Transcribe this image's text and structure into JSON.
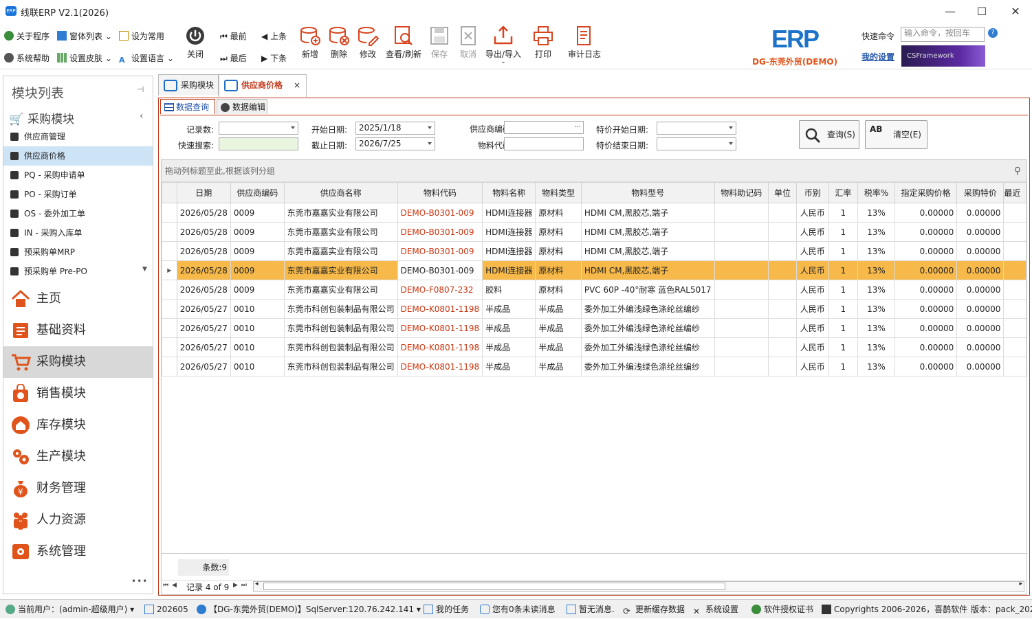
{
  "window": {
    "title": "线联ERP V2.1(2026)",
    "logo": "ERP"
  },
  "ribbon": {
    "small_left": [
      {
        "label": "关于程序",
        "icon": "gear-icon"
      },
      {
        "label": "窗体列表",
        "icon": "windows-icon"
      },
      {
        "label": "设为常用",
        "icon": "clipboard-icon"
      },
      {
        "label": "系统帮助",
        "icon": "help-icon"
      },
      {
        "label": "设置皮肤",
        "icon": "grid-icon"
      },
      {
        "label": "设置语言",
        "icon": "language-icon"
      }
    ],
    "close": "关闭",
    "nav": {
      "first": "最前",
      "prev": "上条",
      "last": "最后",
      "next": "下条"
    },
    "buttons": [
      "新增",
      "删除",
      "修改",
      "查看/刷新",
      "保存",
      "取消",
      "导出/导入",
      "打印",
      "审计日志"
    ],
    "brand": {
      "name": "DG-东莞外贸(DEMO)",
      "logo": "ERP"
    },
    "quick_cmd_label": "快速命令",
    "quick_cmd_placeholder": "输入命令，按回车",
    "my_settings": "我的设置",
    "banner": "CSFramework"
  },
  "left": {
    "header": "模块列表",
    "group": "采购模块",
    "items": [
      "供应商管理",
      "供应商价格",
      "PQ - 采购申请单",
      "PO - 采购订单",
      "OS - 委外加工单",
      "IN - 采购入库单",
      "预采购单MRP",
      "预采购单 Pre-PO"
    ],
    "modules": [
      "主页",
      "基础资料",
      "采购模块",
      "销售模块",
      "库存模块",
      "生产模块",
      "财务管理",
      "人力资源",
      "系统管理"
    ],
    "more": "•••"
  },
  "tabs": [
    {
      "label": "采购模块"
    },
    {
      "label": "供应商价格"
    }
  ],
  "subtabs": [
    "数据查询",
    "数据编辑"
  ],
  "query": {
    "record_count_label": "记录数:",
    "quick_search_label": "快速搜索:",
    "start_date_label": "开始日期:",
    "start_date": "2025/1/18",
    "end_date_label": "截止日期:",
    "end_date": "2026/7/25",
    "supplier_code_label": "供应商编码:",
    "material_code_label": "物料代码:",
    "special_start_label": "特价开始日期:",
    "special_end_label": "特价结束日期:",
    "search_button": "查询(S)",
    "clear_button": "清空(E)",
    "ellipsis": "···"
  },
  "grid": {
    "group_hint": "拖动列标题至此,根据该列分组",
    "columns": [
      "日期",
      "供应商编码",
      "供应商名称",
      "物料代码",
      "物料名称",
      "物料类型",
      "物料型号",
      "物料助记码",
      "单位",
      "币别",
      "汇率",
      "税率%",
      "指定采购价格",
      "采购特价",
      "最近"
    ],
    "rows": [
      [
        "2026/05/28",
        "0009",
        "东莞市嘉嘉实业有限公司",
        "DEMO-B0301-009",
        "HDMI连接器",
        "原材料",
        "HDMI CM,黑胶芯,端子",
        "",
        "",
        "人民币",
        "1",
        "13%",
        "0.00000",
        "0.00000",
        ""
      ],
      [
        "2026/05/28",
        "0009",
        "东莞市嘉嘉实业有限公司",
        "DEMO-B0301-009",
        "HDMI连接器",
        "原材料",
        "HDMI CM,黑胶芯,端子",
        "",
        "",
        "人民币",
        "1",
        "13%",
        "0.00000",
        "0.00000",
        ""
      ],
      [
        "2026/05/28",
        "0009",
        "东莞市嘉嘉实业有限公司",
        "DEMO-B0301-009",
        "HDMI连接器",
        "原材料",
        "HDMI CM,黑胶芯,端子",
        "",
        "",
        "人民币",
        "1",
        "13%",
        "0.00000",
        "0.00000",
        ""
      ],
      [
        "2026/05/28",
        "0009",
        "东莞市嘉嘉实业有限公司",
        "DEMO-B0301-009",
        "HDMI连接器",
        "原材料",
        "HDMI CM,黑胶芯,端子",
        "",
        "",
        "人民币",
        "1",
        "13%",
        "0.00000",
        "0.00000",
        ""
      ],
      [
        "2026/05/28",
        "0009",
        "东莞市嘉嘉实业有限公司",
        "DEMO-F0807-232",
        "胶料",
        "原材料",
        "PVC 60P -40°耐寒 蓝色RAL5017",
        "",
        "",
        "人民币",
        "1",
        "13%",
        "0.00000",
        "0.00000",
        ""
      ],
      [
        "2026/05/27",
        "0010",
        "东莞市科创包装制品有限公司",
        "DEMO-K0801-1198",
        "半成品",
        "半成品",
        "委外加工外编浅绿色涤纶丝编纱",
        "",
        "",
        "人民币",
        "1",
        "13%",
        "0.00000",
        "0.00000",
        ""
      ],
      [
        "2026/05/27",
        "0010",
        "东莞市科创包装制品有限公司",
        "DEMO-K0801-1198",
        "半成品",
        "半成品",
        "委外加工外编浅绿色涤纶丝编纱",
        "",
        "",
        "人民币",
        "1",
        "13%",
        "0.00000",
        "0.00000",
        ""
      ],
      [
        "2026/05/27",
        "0010",
        "东莞市科创包装制品有限公司",
        "DEMO-K0801-1198",
        "半成品",
        "半成品",
        "委外加工外编浅绿色涤纶丝编纱",
        "",
        "",
        "人民币",
        "1",
        "13%",
        "0.00000",
        "0.00000",
        ""
      ],
      [
        "2026/05/27",
        "0010",
        "东莞市科创包装制品有限公司",
        "DEMO-K0801-1198",
        "半成品",
        "半成品",
        "委外加工外编浅绿色涤纶丝编纱",
        "",
        "",
        "人民币",
        "1",
        "13%",
        "0.00000",
        "0.00000",
        ""
      ]
    ],
    "selected_row": 3,
    "count_label": "条数:9",
    "record_nav": "记录 4 of 9"
  },
  "status": {
    "user": "当前用户：(admin-超级用户)",
    "period": "202605",
    "db": "【DG-东莞外贸(DEMO)】SqlServer:120.76.242.141",
    "tasks": "我的任务",
    "messages": "您有0条未读消息",
    "notice": "暂无消息.",
    "cache": "更新缓存数据",
    "settings": "系统设置",
    "license": "软件授权证书",
    "copyright": "Copyrights 2006-2026，喜鹊软件",
    "version": "版本：pack_202"
  }
}
